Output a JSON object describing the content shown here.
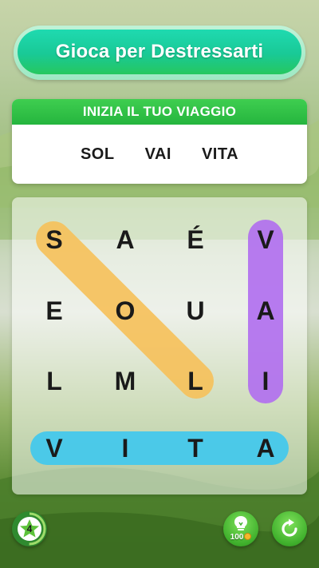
{
  "header": {
    "title": "Gioca per Destressarti"
  },
  "words_card": {
    "title": "INIZIA IL TUO VIAGGIO",
    "words": [
      "SOL",
      "VAI",
      "VITA"
    ]
  },
  "board": {
    "rows": [
      [
        "S",
        "A",
        "É",
        "V"
      ],
      [
        "E",
        "O",
        "U",
        "A"
      ],
      [
        "L",
        "M",
        "L",
        "I"
      ],
      [
        "V",
        "I",
        "T",
        "A"
      ]
    ],
    "found_highlights": [
      {
        "word": "SOL",
        "color": "#f7c15a"
      },
      {
        "word": "VAI",
        "color": "#b16ef0"
      },
      {
        "word": "VITA",
        "color": "#45c9ec"
      }
    ]
  },
  "footer": {
    "level": "4",
    "level_icon": "star-icon",
    "hint_icon": "lightbulb-icon",
    "hint_cost": "100",
    "coin_icon": "coin-icon",
    "refresh_icon": "refresh-icon"
  }
}
